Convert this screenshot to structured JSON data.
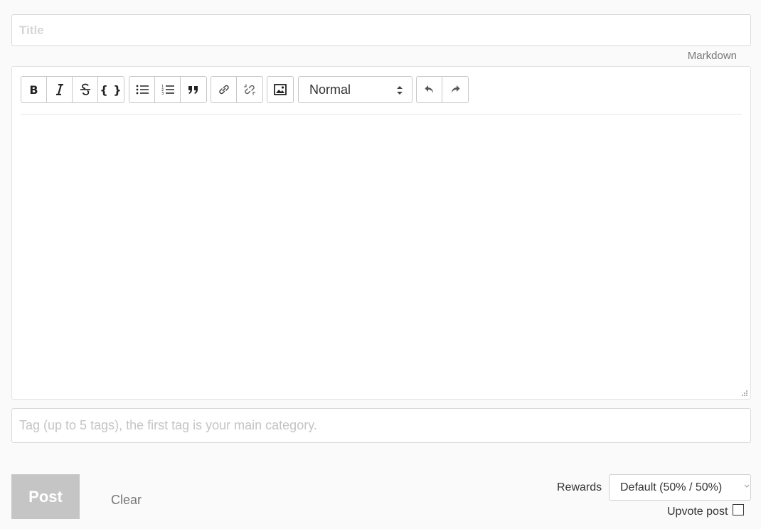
{
  "title_field": {
    "placeholder": "Title",
    "value": ""
  },
  "markdown_link": "Markdown",
  "toolbar": {
    "format_select": "Normal",
    "icons": [
      "bold-icon",
      "italic-icon",
      "strikethrough-icon",
      "code-icon",
      "bullet-list-icon",
      "numbered-list-icon",
      "quote-icon",
      "link-icon",
      "unlink-icon",
      "image-icon",
      "undo-icon",
      "redo-icon"
    ]
  },
  "editor": {
    "value": ""
  },
  "tags_field": {
    "placeholder": "Tag (up to 5 tags), the first tag is your main category.",
    "value": ""
  },
  "actions": {
    "post_label": "Post",
    "clear_label": "Clear",
    "rewards_label": "Rewards",
    "rewards_value": "Default (50% / 50%)",
    "upvote_label": "Upvote post",
    "upvote_checked": false
  },
  "colors": {
    "post_disabled_bg": "#c5c5c5",
    "border": "#d9d9d9",
    "muted_text": "#777777"
  }
}
